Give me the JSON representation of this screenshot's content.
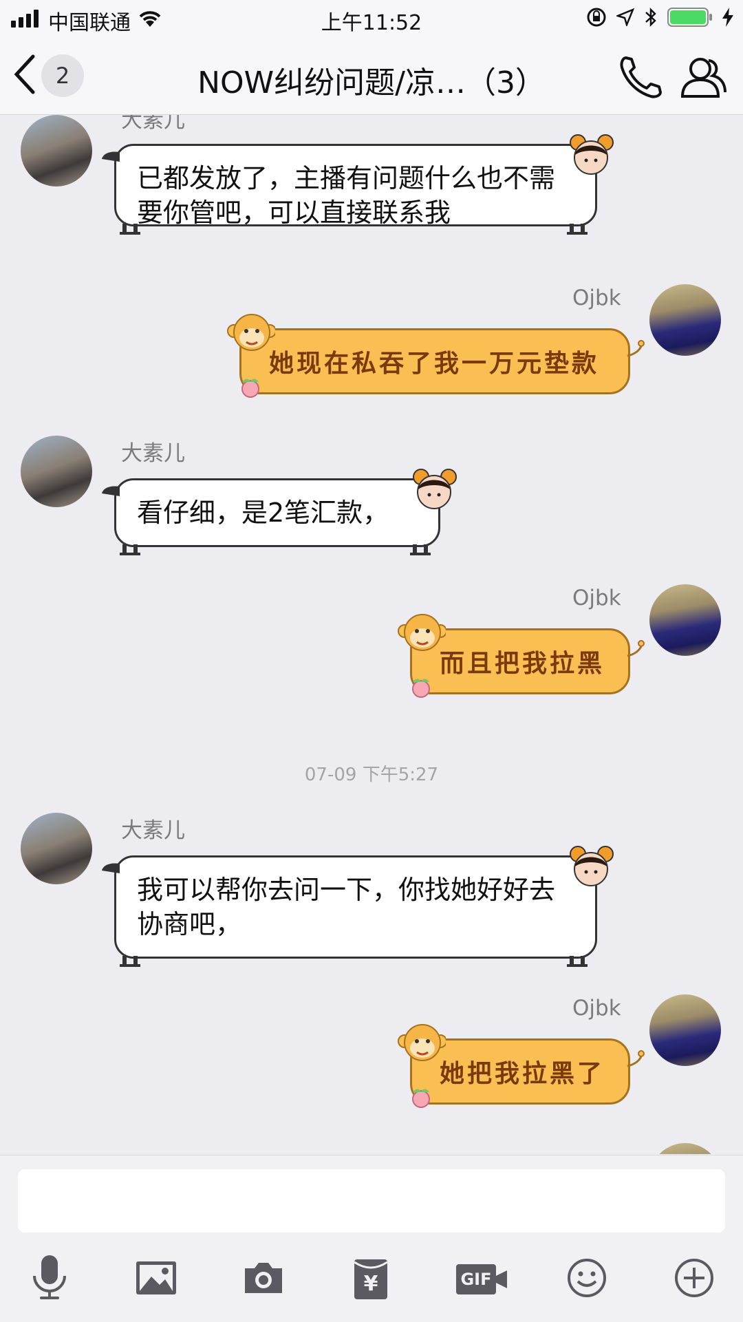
{
  "status_bar": {
    "carrier": "中国联通",
    "time": "上午11:52"
  },
  "nav": {
    "unread_badge": "2",
    "title": "NOW纠纷问题/凉…（3）"
  },
  "messages": [
    {
      "side": "left",
      "sender": "大素儿",
      "text": "已都发放了，主播有问题什么也不需要你管吧，可以直接联系我"
    },
    {
      "side": "right",
      "sender": "Ojbk",
      "text": "她现在私吞了我一万元垫款"
    },
    {
      "side": "left",
      "sender": "大素儿",
      "text": "看仔细，是2笔汇款，"
    },
    {
      "side": "right",
      "sender": "Ojbk",
      "text": "而且把我拉黑"
    },
    {
      "type": "timestamp",
      "text": "07-09 下午5:27"
    },
    {
      "side": "left",
      "sender": "大素儿",
      "text": "我可以帮你去问一下，你找她好好去协商吧，"
    },
    {
      "side": "right",
      "sender": "Ojbk",
      "text": "她把我拉黑了"
    }
  ],
  "input": {
    "value": "",
    "placeholder": ""
  },
  "toolbar": {
    "icons": [
      "microphone-icon",
      "image-icon",
      "camera-icon",
      "red-packet-icon",
      "gif-icon",
      "emoji-icon",
      "plus-icon"
    ],
    "gif_label": "GIF",
    "red_packet_label": "¥"
  },
  "colors": {
    "background": "#ececf1",
    "self_bubble": "#f9bf52",
    "self_bubble_text": "#7a3a0e",
    "other_bubble": "#ffffff",
    "battery": "#4cd964"
  }
}
